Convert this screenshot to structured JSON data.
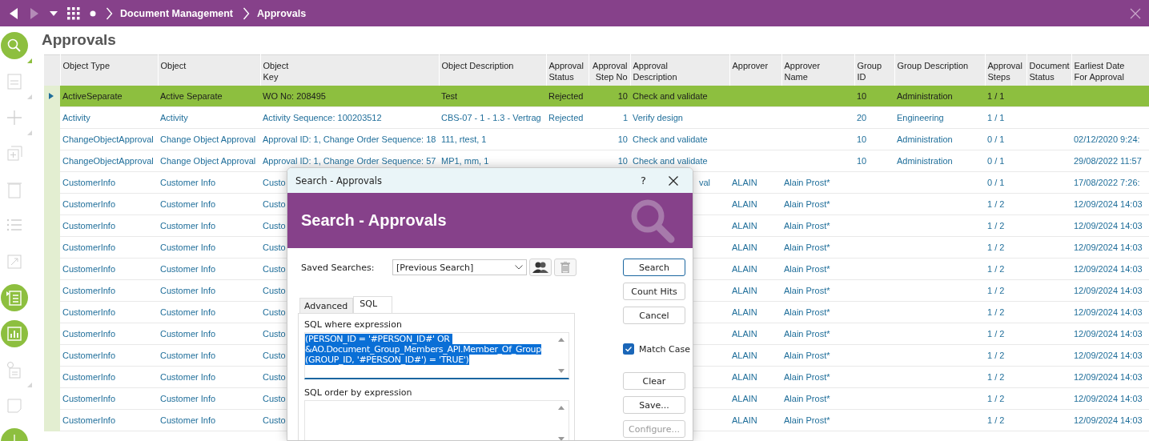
{
  "topbar": {
    "breadcrumb": [
      "Document Management",
      "Approvals"
    ]
  },
  "page_title": "Approvals",
  "sidebar": {
    "items": [
      {
        "kind": "search",
        "disabled": false,
        "menu": true
      },
      {
        "kind": "form",
        "disabled": true,
        "menu": true
      },
      {
        "kind": "plus",
        "disabled": true,
        "menu": true
      },
      {
        "kind": "copy",
        "disabled": true,
        "menu": false
      },
      {
        "kind": "trash",
        "disabled": true,
        "menu": false
      },
      {
        "kind": "list",
        "disabled": true,
        "menu": false
      },
      {
        "kind": "export",
        "disabled": true,
        "menu": false
      },
      {
        "kind": "document",
        "disabled": false,
        "menu": false
      },
      {
        "kind": "chart",
        "disabled": false,
        "menu": false
      },
      {
        "kind": "info",
        "disabled": true,
        "menu": true
      },
      {
        "kind": "note",
        "disabled": true,
        "menu": false
      },
      {
        "kind": "plus",
        "disabled": false
      }
    ]
  },
  "table": {
    "columns": [
      {
        "label": "Object Type",
        "kind": "text"
      },
      {
        "label": "Object",
        "kind": "text"
      },
      {
        "label": "Object\nKey",
        "kind": "text"
      },
      {
        "label": "Object Description",
        "kind": "text"
      },
      {
        "label": "Approval\nStatus",
        "kind": "text"
      },
      {
        "label": "Approval\nStep No",
        "kind": "number"
      },
      {
        "label": "Approval\n Description",
        "kind": "text"
      },
      {
        "label": "Approver",
        "kind": "text"
      },
      {
        "label": "Approver\nName",
        "kind": "text"
      },
      {
        "label": "Group ID",
        "kind": "text"
      },
      {
        "label": "Group Description",
        "kind": "text"
      },
      {
        "label": "Approval\nSteps",
        "kind": "text"
      },
      {
        "label": "Document\nStatus",
        "kind": "text"
      },
      {
        "label": "Earliest Date\nFor Approval",
        "kind": "text"
      }
    ],
    "rows": [
      {
        "selected": true,
        "cells": [
          "ActiveSeparate",
          "Active Separate",
          "WO No: 208495",
          "Test",
          "Rejected",
          "10",
          "Check and validate",
          null,
          null,
          "10",
          "Administration",
          "1 / 1",
          null,
          null
        ]
      },
      {
        "selected": false,
        "cells": [
          "Activity",
          "Activity",
          "Activity Sequence: 100203512",
          "CBS-07 - 1 - 1.3 - Vertrag",
          "Rejected",
          "1",
          "Verify design",
          null,
          null,
          "20",
          "Engineering",
          "1 / 1",
          null,
          null
        ]
      },
      {
        "selected": false,
        "cells": [
          "ChangeObjectApproval",
          "Change Object Approval",
          "Approval ID: 1, Change Order Sequence: 18",
          "111, rtest, 1",
          null,
          "10",
          "Check and validate",
          null,
          null,
          "10",
          "Administration",
          "0 / 1",
          null,
          "02/12/2020 9:24:"
        ]
      },
      {
        "selected": false,
        "cells": [
          "ChangeObjectApproval",
          "Change Object Approval",
          "Approval ID: 1, Change Order Sequence: 57",
          "MP1, mm, 1",
          null,
          "10",
          "Check and validate",
          null,
          null,
          "10",
          "Administration",
          "0 / 1",
          null,
          "29/08/2022 11:57"
        ]
      },
      {
        "selected": false,
        "cells": [
          "CustomerInfo",
          "Customer Info",
          "Custo",
          null,
          null,
          null,
          {
            "text": "val",
            "clipped": true
          },
          "ALAIN",
          "Alain Prost*",
          null,
          null,
          "0 / 1",
          null,
          "17/08/2022 7:26:"
        ]
      },
      {
        "selected": false,
        "cells": [
          "CustomerInfo",
          "Customer Info",
          "Custo",
          null,
          null,
          null,
          null,
          "ALAIN",
          "Alain Prost*",
          null,
          null,
          "1 / 2",
          null,
          "12/09/2024 14:03"
        ]
      },
      {
        "selected": false,
        "cells": [
          "CustomerInfo",
          "Customer Info",
          "Custo",
          null,
          null,
          null,
          null,
          "ALAIN",
          "Alain Prost*",
          null,
          null,
          "1 / 2",
          null,
          "12/09/2024 14:03"
        ]
      },
      {
        "selected": false,
        "cells": [
          "CustomerInfo",
          "Customer Info",
          "Custo",
          null,
          null,
          null,
          null,
          "ALAIN",
          "Alain Prost*",
          null,
          null,
          "1 / 2",
          null,
          "12/09/2024 14:03"
        ]
      },
      {
        "selected": false,
        "cells": [
          "CustomerInfo",
          "Customer Info",
          "Custo",
          null,
          null,
          null,
          null,
          "ALAIN",
          "Alain Prost*",
          null,
          null,
          "1 / 2",
          null,
          "12/09/2024 14:03"
        ]
      },
      {
        "selected": false,
        "cells": [
          "CustomerInfo",
          "Customer Info",
          "Custo",
          null,
          null,
          null,
          null,
          "ALAIN",
          "Alain Prost*",
          null,
          null,
          "1 / 2",
          null,
          "12/09/2024 14:03"
        ]
      },
      {
        "selected": false,
        "cells": [
          "CustomerInfo",
          "Customer Info",
          "Custo",
          null,
          null,
          null,
          null,
          "ALAIN",
          "Alain Prost*",
          null,
          null,
          "1 / 2",
          null,
          "12/09/2024 14:03"
        ]
      },
      {
        "selected": false,
        "cells": [
          "CustomerInfo",
          "Customer Info",
          "Custo",
          null,
          null,
          null,
          null,
          "ALAIN",
          "Alain Prost*",
          null,
          null,
          "1 / 2",
          null,
          "12/09/2024 14:03"
        ]
      },
      {
        "selected": false,
        "cells": [
          "CustomerInfo",
          "Customer Info",
          "Custo",
          null,
          null,
          null,
          null,
          "ALAIN",
          "Alain Prost*",
          null,
          null,
          "1 / 2",
          null,
          "12/09/2024 14:03"
        ]
      },
      {
        "selected": false,
        "cells": [
          "CustomerInfo",
          "Customer Info",
          "Custo",
          null,
          null,
          null,
          null,
          "ALAIN",
          "Alain Prost*",
          null,
          null,
          "1 / 2",
          null,
          "12/09/2024 14:03"
        ]
      },
      {
        "selected": false,
        "cells": [
          "CustomerInfo",
          "Customer Info",
          "Custo",
          null,
          null,
          null,
          null,
          "ALAIN",
          "Alain Prost*",
          null,
          null,
          "1 / 2",
          null,
          "12/09/2024 14:03"
        ]
      },
      {
        "selected": false,
        "cells": [
          "CustomerInfo",
          "Customer Info",
          "Custo",
          null,
          null,
          null,
          null,
          "ALAIN",
          "Alain Prost*",
          null,
          null,
          "1 / 2",
          null,
          "12/09/2024 14:03"
        ]
      }
    ]
  },
  "search_dialog": {
    "title": "Search - Approvals",
    "help": "?",
    "header": "Search - Approvals",
    "saved_searches": {
      "label": "Saved Searches:",
      "value": "[Previous Search]"
    },
    "tabs": [
      {
        "label": "Advanced",
        "selected": false
      },
      {
        "label": "SQL",
        "selected": true
      }
    ],
    "where": {
      "label": "SQL where expression",
      "value": "(PERSON_ID = '#PERSON_ID#' OR \n&AO.Document_Group_Members_API.Member_Of_Group\n(GROUP_ID, '#PERSON_ID#') = 'TRUE')",
      "text_selected": true
    },
    "order_by": {
      "label": "SQL order by expression"
    },
    "buttons": [
      {
        "label": "Search",
        "default": true,
        "disabled": false
      },
      {
        "label": "Count Hits",
        "default": false,
        "disabled": false
      },
      {
        "label": "Cancel",
        "default": false,
        "disabled": false
      }
    ],
    "match_case": {
      "label": "Match Case",
      "checked": true
    },
    "more_buttons": [
      {
        "label": "Clear",
        "default": false,
        "disabled": false
      },
      {
        "label": "Save...",
        "default": false,
        "disabled": false
      },
      {
        "label": "Configure...",
        "default": false,
        "disabled": true
      }
    ]
  }
}
